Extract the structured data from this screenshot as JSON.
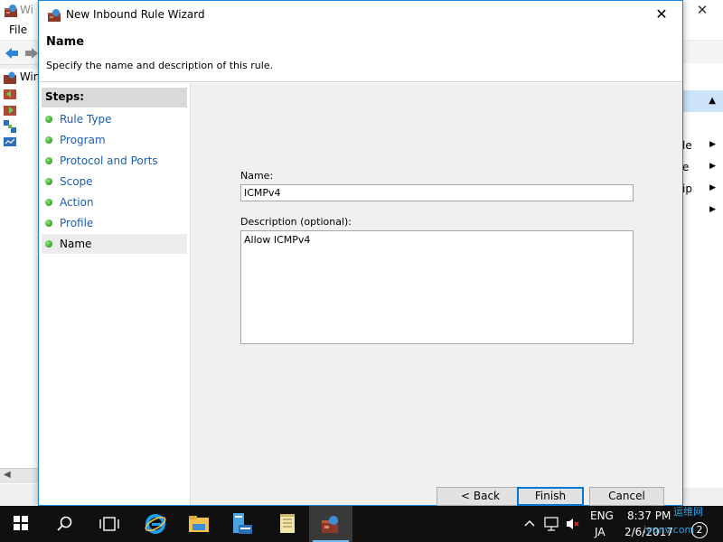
{
  "background_window": {
    "title": "Wi",
    "menu_file": "File",
    "tree_items": [
      "Win",
      "",
      "",
      ""
    ],
    "actions_items": [
      "le",
      "e",
      "ip",
      ""
    ]
  },
  "dialog": {
    "title": "New Inbound Rule Wizard",
    "heading": "Name",
    "subheading": "Specify the name and description of this rule.",
    "steps_header": "Steps:",
    "steps": [
      {
        "label": "Rule Type",
        "current": false
      },
      {
        "label": "Program",
        "current": false
      },
      {
        "label": "Protocol and Ports",
        "current": false
      },
      {
        "label": "Scope",
        "current": false
      },
      {
        "label": "Action",
        "current": false
      },
      {
        "label": "Profile",
        "current": false
      },
      {
        "label": "Name",
        "current": true
      }
    ],
    "name_label": "Name:",
    "name_value": "ICMPv4",
    "description_label": "Description (optional):",
    "description_value": "Allow ICMPv4",
    "buttons": {
      "back": "< Back",
      "finish": "Finish",
      "cancel": "Cancel"
    }
  },
  "taskbar": {
    "pinned": [
      "start-icon",
      "search-icon",
      "task-view-icon",
      "internet-explorer-icon",
      "file-explorer-icon",
      "server-manager-icon",
      "notepad-icon",
      "firewall-icon"
    ],
    "language_top": "ENG",
    "language_bottom": "JA",
    "time": "8:37 PM",
    "date": "2/6/2017",
    "notification_count": "2"
  },
  "watermark": {
    "line1": "运维网",
    "line2": "iyunv.com"
  },
  "colors": {
    "accent": "#0078d7",
    "step_link": "#1c5fab",
    "step_dot": "#2ea51c",
    "taskbar": "#101010"
  }
}
